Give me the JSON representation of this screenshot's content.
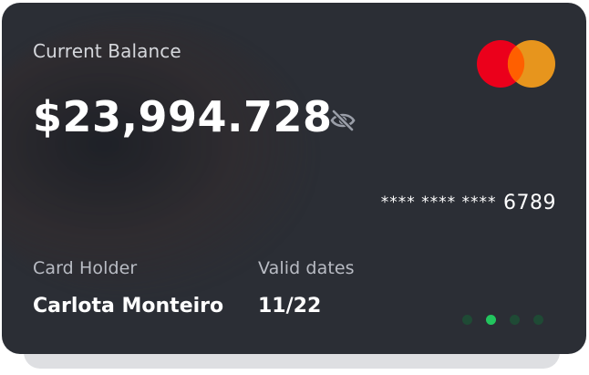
{
  "card": {
    "balance_label": "Current Balance",
    "balance_amount": "$23,994.728",
    "toggle_visibility_icon": "eye-slash-icon",
    "brand_icon": "mastercard-logo",
    "card_number_mask": "**** **** ****",
    "card_number_last4": "6789",
    "holder_label": "Card Holder",
    "holder_name": "Carlota Monteiro",
    "valid_label": "Valid dates",
    "valid_value": "11/22"
  },
  "pagination": {
    "total": 4,
    "active_index": 1
  },
  "colors": {
    "card_background": "#2b2e35",
    "mastercard_red": "#eb001b",
    "mastercard_orange": "#f79e1b",
    "active_dot": "#22c55e"
  }
}
